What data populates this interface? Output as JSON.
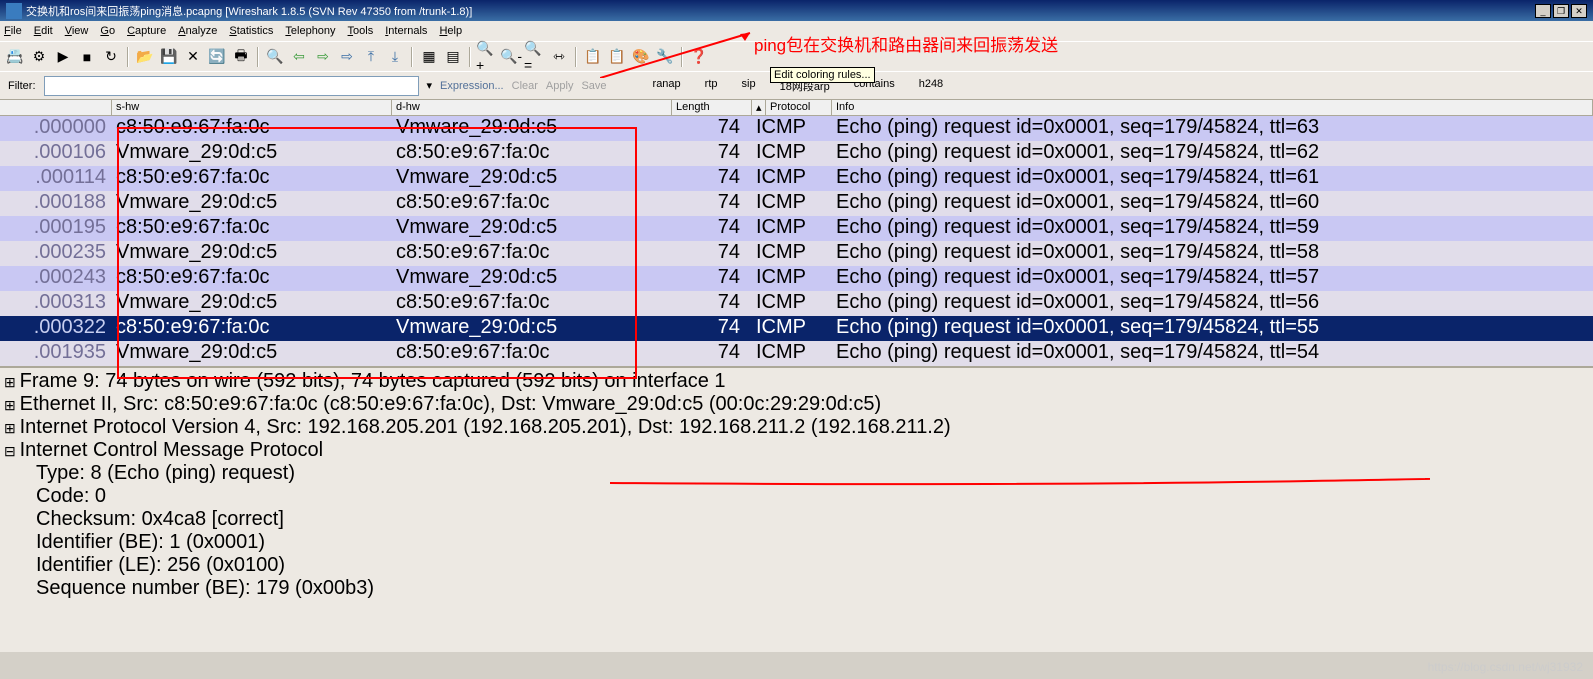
{
  "title": "交换机和ros间来回振荡ping消息.pcapng   [Wireshark 1.8.5  (SVN Rev 47350 from /trunk-1.8)]",
  "winbtns": {
    "min": "_",
    "max": "❐",
    "close": "✕"
  },
  "menu": [
    "File",
    "Edit",
    "View",
    "Go",
    "Capture",
    "Analyze",
    "Statistics",
    "Telephony",
    "Tools",
    "Internals",
    "Help"
  ],
  "tooltip": "Edit coloring rules...",
  "annotation": "ping包在交换机和路由器间来回振荡发送",
  "filter": {
    "label": "Filter:",
    "value": "",
    "expr": "Expression...",
    "clear": "Clear",
    "apply": "Apply",
    "save": "Save",
    "extras": [
      "ranap",
      "rtp",
      "sip",
      "18网段arp",
      "contains",
      "h248"
    ]
  },
  "cols": [
    "",
    "s-hw",
    "d-hw",
    "Length",
    "",
    "Protocol",
    "Info"
  ],
  "rows": [
    {
      "t": ".000000",
      "s": "c8:50:e9:67:fa:0c",
      "d": "Vmware_29:0d:c5",
      "l": "74",
      "p": "ICMP",
      "i": "Echo (ping) request  id=0x0001, seq=179/45824, ttl=63",
      "sel": false,
      "cls": "even"
    },
    {
      "t": ".000106",
      "s": "Vmware_29:0d:c5",
      "d": "c8:50:e9:67:fa:0c",
      "l": "74",
      "p": "ICMP",
      "i": "Echo (ping) request  id=0x0001, seq=179/45824, ttl=62",
      "sel": false,
      "cls": "odd"
    },
    {
      "t": ".000114",
      "s": "c8:50:e9:67:fa:0c",
      "d": "Vmware_29:0d:c5",
      "l": "74",
      "p": "ICMP",
      "i": "Echo (ping) request  id=0x0001, seq=179/45824, ttl=61",
      "sel": false,
      "cls": "even"
    },
    {
      "t": ".000188",
      "s": "Vmware_29:0d:c5",
      "d": "c8:50:e9:67:fa:0c",
      "l": "74",
      "p": "ICMP",
      "i": "Echo (ping) request  id=0x0001, seq=179/45824, ttl=60",
      "sel": false,
      "cls": "odd"
    },
    {
      "t": ".000195",
      "s": "c8:50:e9:67:fa:0c",
      "d": "Vmware_29:0d:c5",
      "l": "74",
      "p": "ICMP",
      "i": "Echo (ping) request  id=0x0001, seq=179/45824, ttl=59",
      "sel": false,
      "cls": "even"
    },
    {
      "t": ".000235",
      "s": "Vmware_29:0d:c5",
      "d": "c8:50:e9:67:fa:0c",
      "l": "74",
      "p": "ICMP",
      "i": "Echo (ping) request  id=0x0001, seq=179/45824, ttl=58",
      "sel": false,
      "cls": "odd"
    },
    {
      "t": ".000243",
      "s": "c8:50:e9:67:fa:0c",
      "d": "Vmware_29:0d:c5",
      "l": "74",
      "p": "ICMP",
      "i": "Echo (ping) request  id=0x0001, seq=179/45824, ttl=57",
      "sel": false,
      "cls": "even"
    },
    {
      "t": ".000313",
      "s": "Vmware_29:0d:c5",
      "d": "c8:50:e9:67:fa:0c",
      "l": "74",
      "p": "ICMP",
      "i": "Echo (ping) request  id=0x0001, seq=179/45824, ttl=56",
      "sel": false,
      "cls": "odd"
    },
    {
      "t": ".000322",
      "s": "c8:50:e9:67:fa:0c",
      "d": "Vmware_29:0d:c5",
      "l": "74",
      "p": "ICMP",
      "i": "Echo (ping) request  id=0x0001, seq=179/45824, ttl=55",
      "sel": true,
      "cls": "sel"
    },
    {
      "t": ".001935",
      "s": "Vmware_29:0d:c5",
      "d": "c8:50:e9:67:fa:0c",
      "l": "74",
      "p": "ICMP",
      "i": "Echo (ping) request  id=0x0001, seq=179/45824, ttl=54",
      "sel": false,
      "cls": "odd"
    }
  ],
  "details": [
    {
      "cls": "tree",
      "txt": "Frame 9: 74 bytes on wire (592 bits), 74 bytes captured (592 bits) on interface 1"
    },
    {
      "cls": "tree",
      "txt": "Ethernet II, Src: c8:50:e9:67:fa:0c (c8:50:e9:67:fa:0c), Dst: Vmware_29:0d:c5 (00:0c:29:29:0d:c5)"
    },
    {
      "cls": "tree",
      "txt": "Internet Protocol Version 4, Src: 192.168.205.201 (192.168.205.201), Dst: 192.168.211.2 (192.168.211.2)"
    },
    {
      "cls": "treeo",
      "txt": "Internet Control Message Protocol"
    },
    {
      "cls": "indent",
      "txt": "Type: 8 (Echo (ping) request)"
    },
    {
      "cls": "indent",
      "txt": "Code: 0"
    },
    {
      "cls": "indent",
      "txt": "Checksum: 0x4ca8 [correct]"
    },
    {
      "cls": "indent",
      "txt": "Identifier (BE): 1 (0x0001)"
    },
    {
      "cls": "indent",
      "txt": "Identifier (LE): 256 (0x0100)"
    },
    {
      "cls": "indent",
      "txt": "Sequence number (BE): 179 (0x00b3)"
    }
  ],
  "watermark": "https://blog.csdn.net/wj31932"
}
